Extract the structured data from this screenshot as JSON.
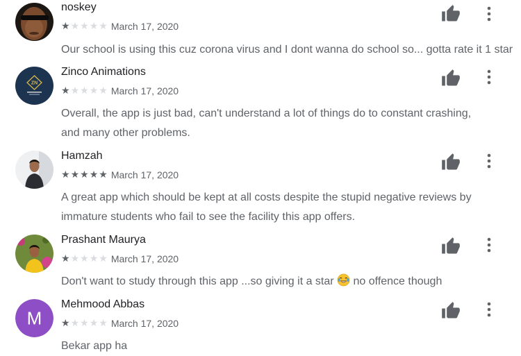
{
  "reviews": [
    {
      "name": "noskey",
      "rating": 1,
      "date": "March 17, 2020",
      "text": "Our school is using this cuz corona virus and I dont wanna do school so... gotta rate it 1 star",
      "avatar": "photo-dark-face"
    },
    {
      "name": "Zinco Animations",
      "rating": 1,
      "date": "March 17, 2020",
      "text": "Overall, the app is just bad, can't understand a lot of things do to constant crashing, and many other problems.",
      "avatar": "logo-zn",
      "avatar_logo_text": "ZN"
    },
    {
      "name": "Hamzah",
      "rating": 5,
      "date": "March 17, 2020",
      "text": "A great app which should be kept at all costs despite the stupid negative reviews by immature students who fail to see the facility this app offers.",
      "avatar": "photo-person"
    },
    {
      "name": "Prashant Maurya",
      "rating": 1,
      "date": "March 17, 2020",
      "text_before": "Don't want to study through this app ...so giving it a star",
      "text_emoji": "😂",
      "text_after": "no offence though",
      "avatar": "photo-person-outdoor"
    },
    {
      "name": "Mehmood Abbas",
      "rating": 1,
      "date": "March 17, 2020",
      "text": "Bekar app ha",
      "avatar": "letter-avatar",
      "avatar_letter": "M",
      "avatar_color": "#8e4ec6"
    }
  ],
  "colors": {
    "star_on": "#5f6368",
    "star_off": "#dadce0",
    "secondary_text": "#5f6368"
  },
  "icons": {
    "helpful": "thumb-up-icon",
    "menu": "more-vert-icon",
    "star": "star-icon"
  }
}
